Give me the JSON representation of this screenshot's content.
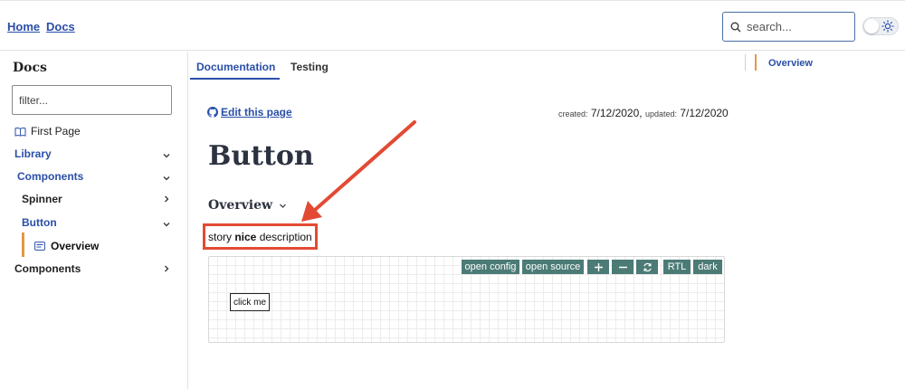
{
  "header": {
    "nav": [
      {
        "label": "Home"
      },
      {
        "label": "Docs"
      }
    ],
    "search_placeholder": "search...",
    "theme_toggle_icon": "sun-icon"
  },
  "sidebar": {
    "title": "Docs",
    "filter_placeholder": "filter...",
    "items": [
      {
        "label": "First Page",
        "icon": "book-icon"
      },
      {
        "label": "Library",
        "chevron": "down"
      },
      {
        "label": "Components",
        "chevron": "down"
      },
      {
        "label": "Spinner",
        "chevron": "right"
      },
      {
        "label": "Button",
        "chevron": "down"
      },
      {
        "label": "Overview",
        "icon": "document-icon"
      },
      {
        "label": "Components",
        "chevron": "right"
      }
    ]
  },
  "main": {
    "tabs": [
      {
        "label": "Documentation",
        "active": true
      },
      {
        "label": "Testing",
        "active": false
      }
    ],
    "edit_link": "Edit this page",
    "dates": {
      "created_label": "created:",
      "created": "7/12/2020",
      "updated_label": "updated:",
      "updated": "7/12/2020"
    },
    "title": "Button",
    "section_heading": "Overview",
    "story_description": {
      "pre": "story ",
      "bold": "nice",
      "post": " description"
    },
    "preview": {
      "toolbar": {
        "open_config": "open config",
        "open_source": "open source",
        "rtl": "RTL",
        "dark": "dark"
      },
      "button_label": "click me"
    }
  },
  "toc": {
    "items": [
      {
        "label": "Overview"
      }
    ]
  },
  "colors": {
    "accent_blue": "#2a4ea8",
    "accent_orange": "#e39746",
    "annotation_red": "#e34a33",
    "toolbar_teal": "#4c7b76",
    "heading_dark": "#2c3240"
  }
}
